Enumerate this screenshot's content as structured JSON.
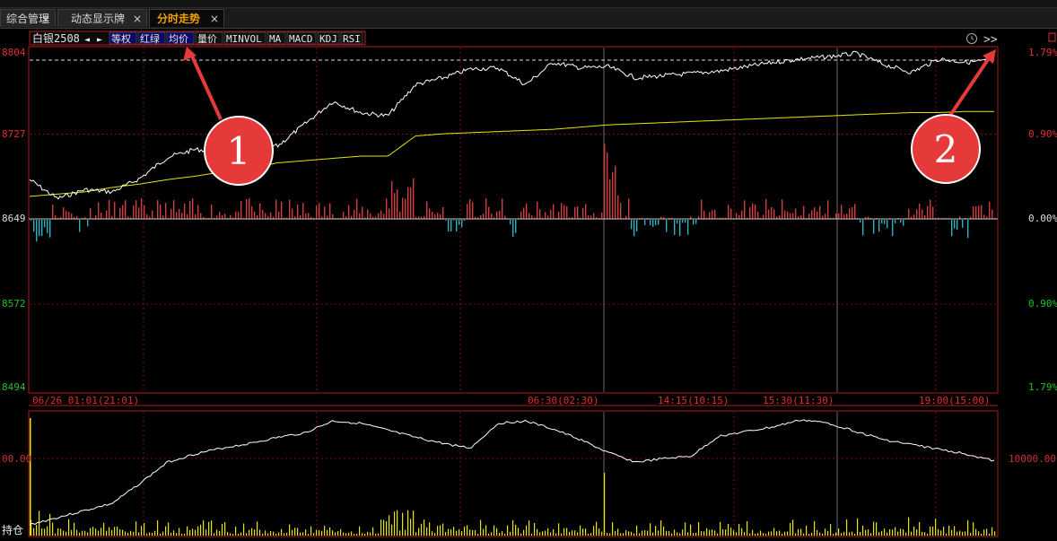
{
  "tabs": [
    {
      "label": "综合管理",
      "close": "×"
    },
    {
      "label": "动态显示牌",
      "close": "×"
    },
    {
      "label": "分时走势",
      "close": "×"
    }
  ],
  "toolbar": {
    "symbol": "白银2508",
    "prev_arrow": "◄",
    "next_arrow": "►",
    "buttons": [
      "等权",
      "红绿",
      "均价",
      "量价",
      "MINVOL",
      "MA",
      "MACD",
      "KDJ",
      "RSI"
    ]
  },
  "price_axis": {
    "left_labels": [
      "8804",
      "8727",
      "8649",
      "8572",
      "8494"
    ],
    "right_labels": [
      "1.79%",
      "0.90%",
      "0.00%",
      "0.90%",
      "1.79%"
    ],
    "range": [
      8494,
      8804
    ],
    "base": 8649
  },
  "time_axis": {
    "labels": [
      "06/26 01:01(21:01)",
      "06:30(02:30)",
      "14:15(10:15)",
      "15:30(11:30)",
      "19:00(15:00)"
    ]
  },
  "lower_panel": {
    "left_value": "00.00",
    "right_value": "10000.00",
    "label": "持仓"
  },
  "annotations": [
    {
      "number": "1",
      "points_to": "均价"
    },
    {
      "number": "2",
      "points_to": ">>"
    }
  ],
  "icons": {
    "clock": "clock-icon",
    "expand": ">>"
  },
  "colors": {
    "price_line": "#ffffff",
    "avg_line": "#e6e600",
    "up_bar": "#d23c3c",
    "down_bar": "#2ab3c0",
    "grid": "#7a1010",
    "frame": "#b01818",
    "axis_red": "#e03030",
    "axis_green": "#20c020",
    "active_tab": "#f0a000",
    "callout": "#e63a3a"
  },
  "chart_data": [
    {
      "type": "line",
      "title": "白银2508 分时走势",
      "ylim": [
        8494,
        8804
      ],
      "series": [
        {
          "name": "price",
          "values": [
            8685,
            8668,
            8676,
            8674,
            8686,
            8705,
            8712,
            8710,
            8716,
            8715,
            8735,
            8755,
            8745,
            8742,
            8770,
            8776,
            8784,
            8785,
            8770,
            8790,
            8785,
            8786,
            8776,
            8778,
            8780,
            8782,
            8786,
            8790,
            8793,
            8795,
            8798,
            8788,
            8781,
            8793,
            8790,
            8792
          ]
        },
        {
          "name": "avg",
          "values": [
            8670,
            8672,
            8674,
            8678,
            8681,
            8685,
            8688,
            8692,
            8695,
            8700,
            8702,
            8704,
            8706,
            8706,
            8724,
            8726,
            8727,
            8728,
            8729,
            8730,
            8732,
            8734,
            8735,
            8736,
            8737,
            8738,
            8739,
            8740,
            8741,
            8742,
            8743,
            8744,
            8745,
            8745,
            8746,
            8746
          ]
        }
      ]
    },
    {
      "type": "line",
      "title": "持仓",
      "series": [
        {
          "name": "open_interest",
          "values": [
            3000,
            3600,
            4200,
            4800,
            6500,
            8300,
            9000,
            9500,
            9900,
            10400,
            10800,
            11800,
            11600,
            11000,
            10400,
            9900,
            9500,
            11600,
            11800,
            11100,
            10200,
            9100,
            8300,
            8600,
            8800,
            10500,
            10900,
            11300,
            11900,
            11600,
            10900,
            10200,
            9800,
            9400,
            9000,
            8400
          ]
        }
      ]
    }
  ]
}
